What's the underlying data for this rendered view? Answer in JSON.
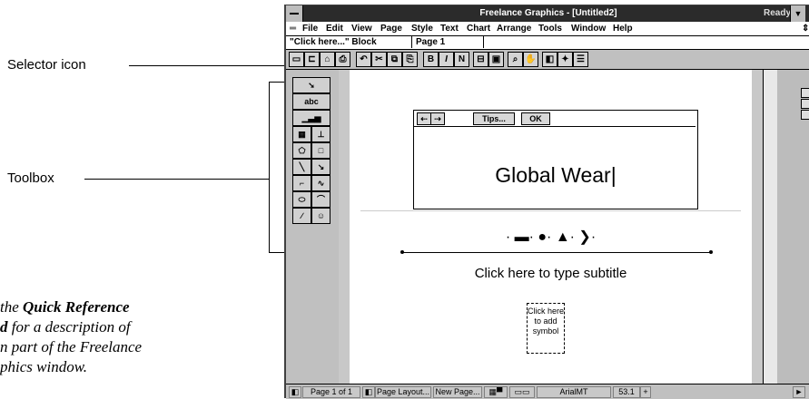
{
  "annotations": {
    "selector_label": "Selector icon",
    "toolbox_label": "Toolbox",
    "side_note": {
      "line1_prefix": "the",
      "line1_bold": "Quick Reference",
      "line2_bold": "d",
      "line2_rest": " for a description of",
      "line3": "n part of the Freelance",
      "line4": "phics window."
    }
  },
  "window": {
    "title": "Freelance Graphics - [Untitled2]",
    "status": "Ready"
  },
  "menu": {
    "items": [
      "File",
      "Edit",
      "View",
      "Page",
      "Style",
      "Text",
      "Chart",
      "Arrange",
      "Tools",
      "Window",
      "Help"
    ]
  },
  "infobar": {
    "selection": "\"Click here...\" Block",
    "page": "Page 1"
  },
  "smarticons": {
    "bold": "B",
    "italic": "I",
    "normal": "N"
  },
  "toolbox": {
    "text_tool": "abc"
  },
  "tips_bar": {
    "tips": "Tips...",
    "ok": "OK"
  },
  "slide": {
    "title": "Global Wear",
    "ornament": "· ▬· ●· ▲· ❯·",
    "subtitle": "Click here to type subtitle",
    "symbol_placeholder": "Click here to add symbol"
  },
  "statusbar": {
    "page_of": "Page 1 of 1",
    "page_layout": "Page Layout...",
    "new_page": "New Page...",
    "font": "ArialMT",
    "size": "53.1"
  }
}
